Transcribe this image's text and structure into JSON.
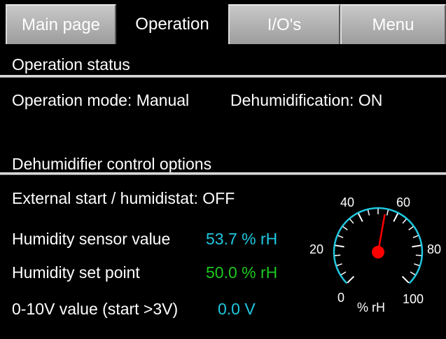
{
  "tabs": [
    {
      "label": "Main page",
      "active": false
    },
    {
      "label": "Operation",
      "active": true
    },
    {
      "label": "I/O's",
      "active": false
    },
    {
      "label": "Menu",
      "active": false
    }
  ],
  "operation_status": {
    "header": "Operation status",
    "mode_label": "Operation mode:",
    "mode_value": "Manual",
    "dehum_label": "Dehumidification:",
    "dehum_value": "ON"
  },
  "control_options": {
    "header": "Dehumidifier control options",
    "external_label": "External start / humidistat:",
    "external_value": "OFF",
    "sensor_label": "Humidity sensor value",
    "sensor_value": "53.7 % rH",
    "setpoint_label": "Humidity set point",
    "setpoint_value": "50.0 % rH",
    "analog_label": "0-10V value (start >3V)",
    "analog_value": "0.0 V"
  },
  "gauge": {
    "ticks": [
      "0",
      "20",
      "40",
      "60",
      "80",
      "100"
    ],
    "unit": "% rH",
    "value": 53.7,
    "min": 0,
    "max": 100,
    "arc_color": "#20c8e0",
    "needle_color": "#ff0000"
  },
  "colors": {
    "cyan": "#20c8e0",
    "green": "#1ec81e"
  }
}
